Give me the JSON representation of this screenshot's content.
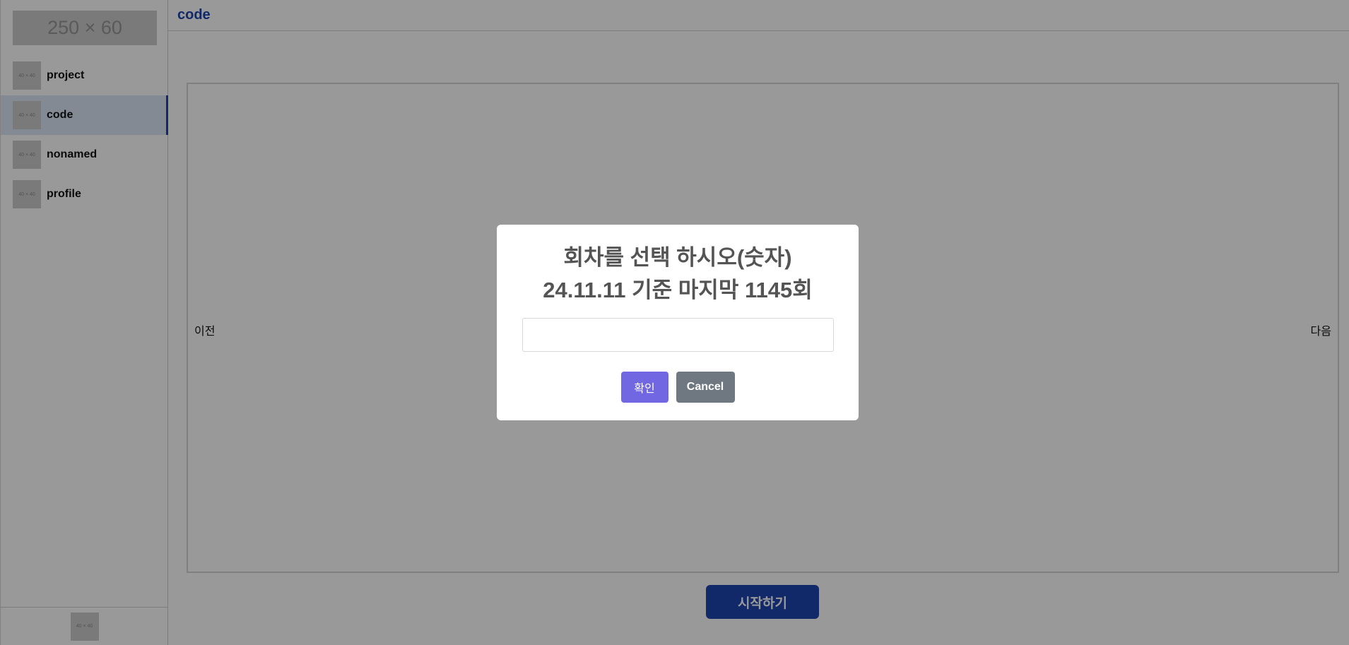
{
  "sidebar": {
    "logo_placeholder": "250 × 60",
    "thumb_placeholder": "40 × 40",
    "items": [
      {
        "label": "project",
        "active": false
      },
      {
        "label": "code",
        "active": true
      },
      {
        "label": "nonamed",
        "active": false
      },
      {
        "label": "profile",
        "active": false
      }
    ],
    "footer_thumb": "40 × 40"
  },
  "header": {
    "title": "code"
  },
  "main": {
    "prev_label": "이전",
    "next_label": "다음",
    "start_label": "시작하기"
  },
  "modal": {
    "title_line1": "회차를 선택 하시오(숫자)",
    "title_line2": "24.11.11 기준 마지막 1145회",
    "input_value": "",
    "confirm_label": "확인",
    "cancel_label": "Cancel"
  },
  "colors": {
    "accent": "#1f45b0",
    "confirm": "#7267e3",
    "cancel": "#6f7881",
    "overlay": "rgba(0,0,0,0.4)"
  }
}
